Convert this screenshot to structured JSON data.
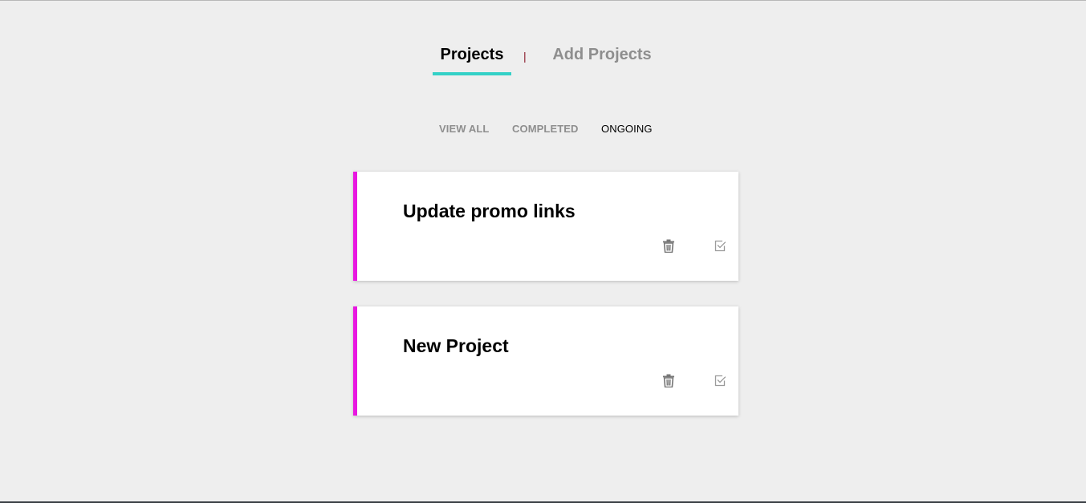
{
  "nav": {
    "tabs": [
      {
        "label": "Projects",
        "active": true
      },
      {
        "label": "Add Projects",
        "active": false
      }
    ],
    "separator": "|"
  },
  "filters": [
    {
      "label": "VIEW ALL",
      "active": false
    },
    {
      "label": "COMPLETED",
      "active": false
    },
    {
      "label": "ONGOING",
      "active": true
    }
  ],
  "projects": [
    {
      "title": "Update promo links",
      "icons": [
        "trash-icon",
        "checkbox-icon"
      ]
    },
    {
      "title": "New Project",
      "icons": [
        "trash-icon",
        "checkbox-icon"
      ]
    }
  ],
  "colors": {
    "background": "#eeeeee",
    "accent_underline": "#34d1c7",
    "card_stripe": "#e817e0",
    "inactive_text": "#8e8e8e",
    "separator": "#8a1a2a"
  }
}
